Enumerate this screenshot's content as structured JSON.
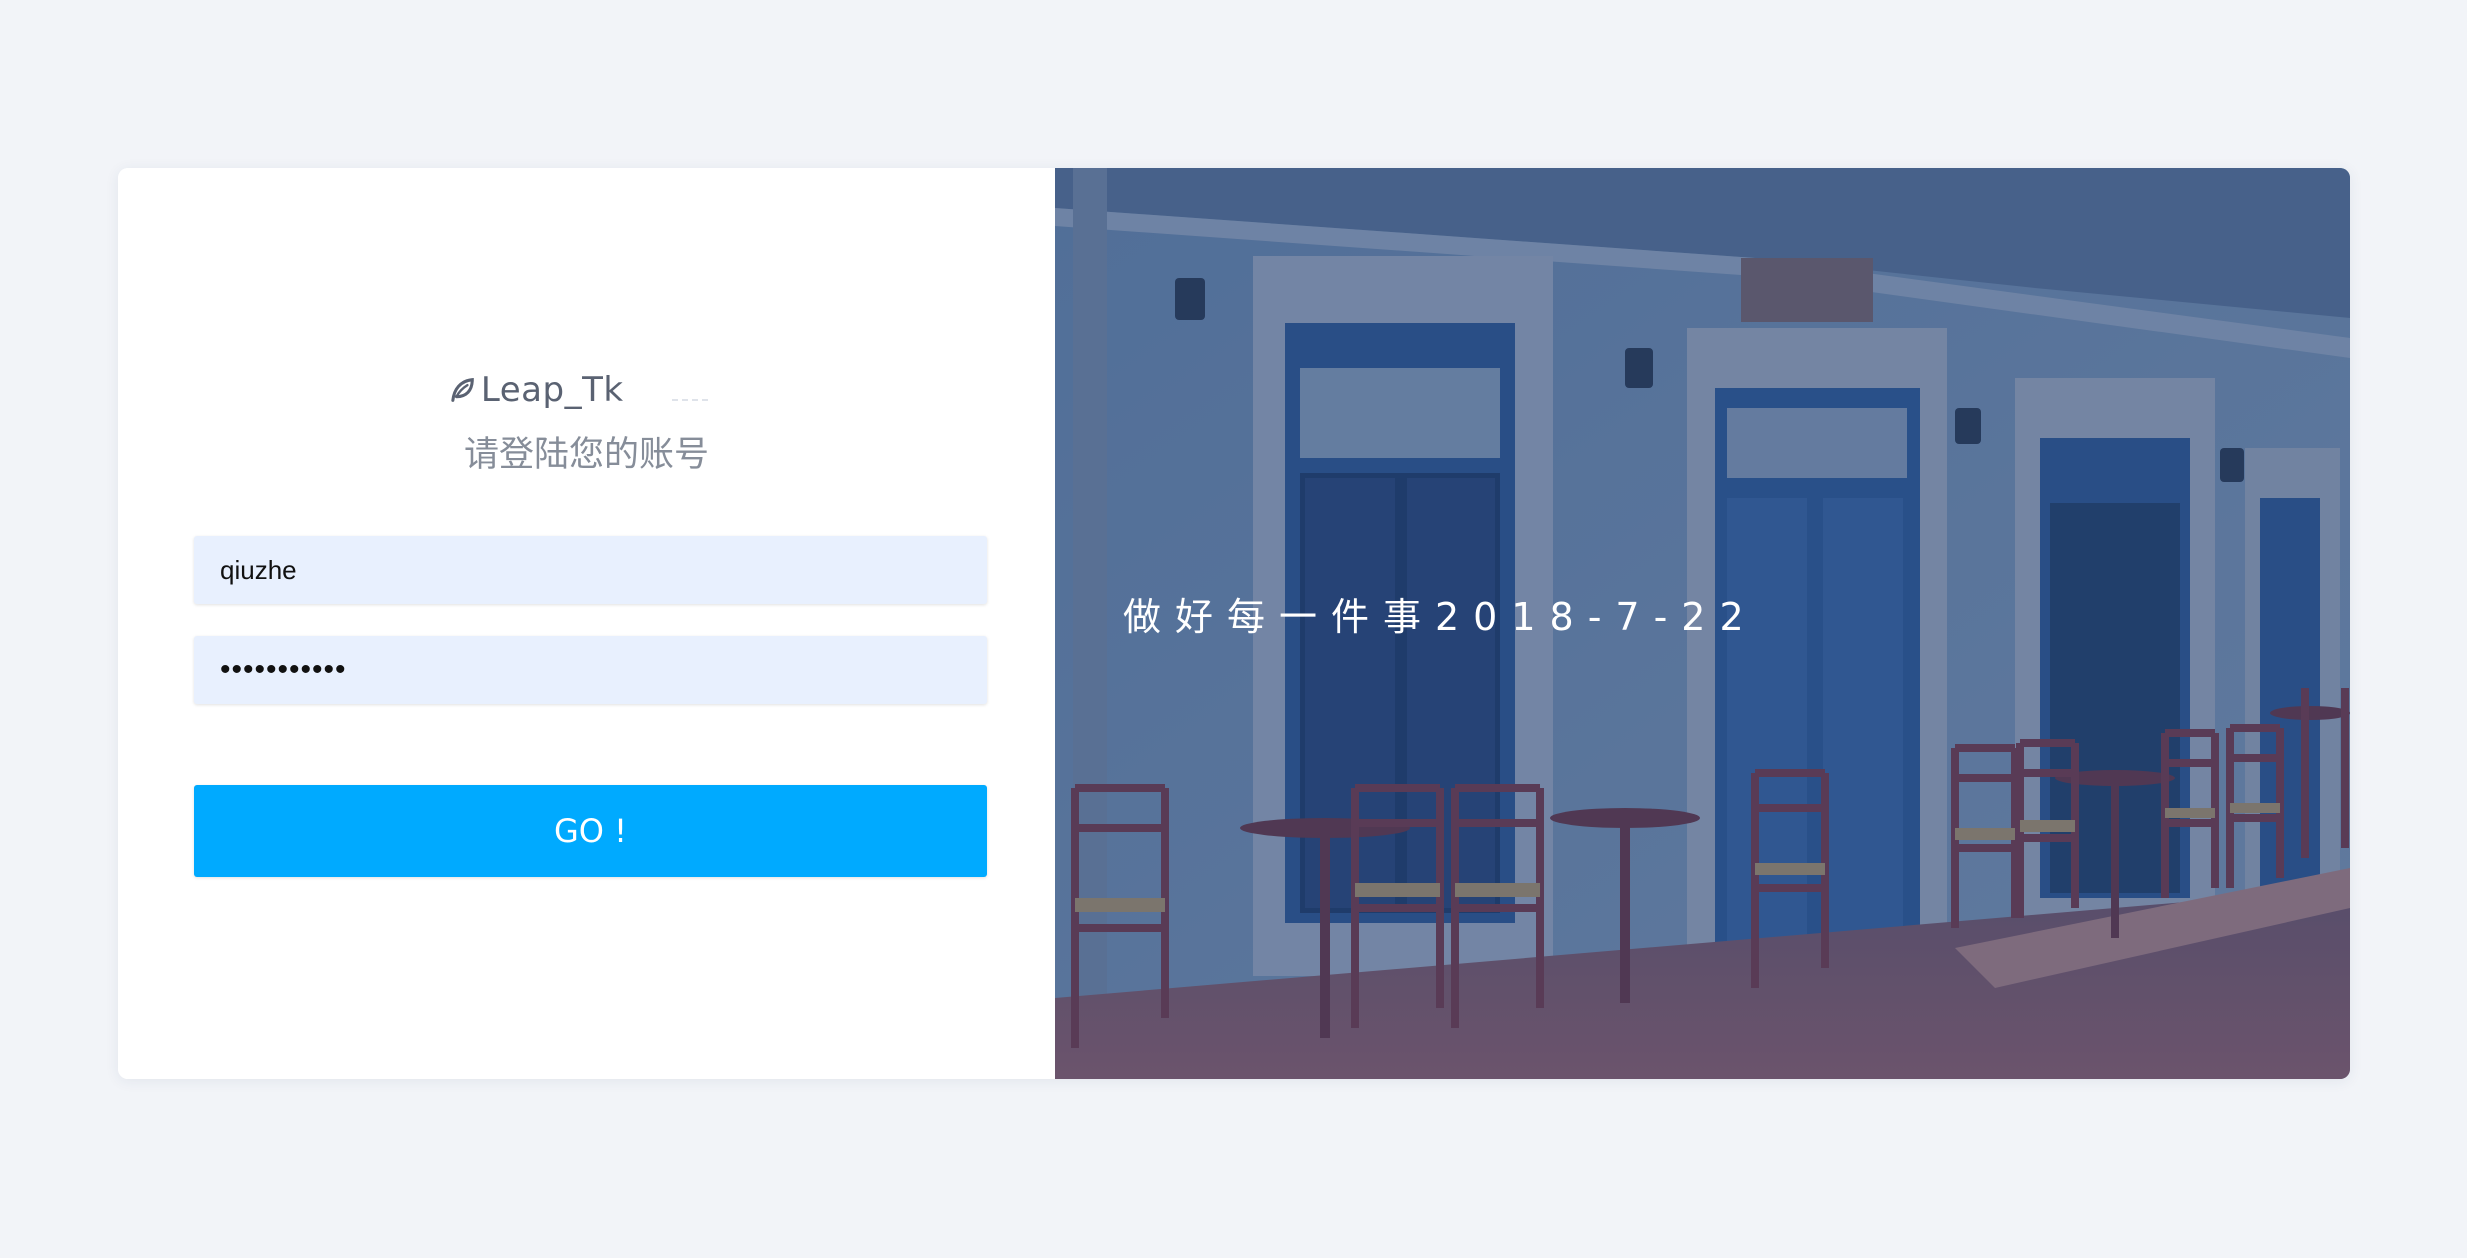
{
  "brand": {
    "name": "Leap_Tk",
    "logo_icon": "leaf-icon"
  },
  "login": {
    "subtitle": "请登陆您的账号",
    "username_value": "qiuzhe",
    "password_value": "•••••••••••",
    "submit_label": "GO !"
  },
  "hero": {
    "slogan": "做好每一件事2018-7-22"
  },
  "colors": {
    "background": "#f2f4f8",
    "input_fill": "#e8f0fe",
    "accent": "#00aaff",
    "overlay": "#203a66"
  }
}
